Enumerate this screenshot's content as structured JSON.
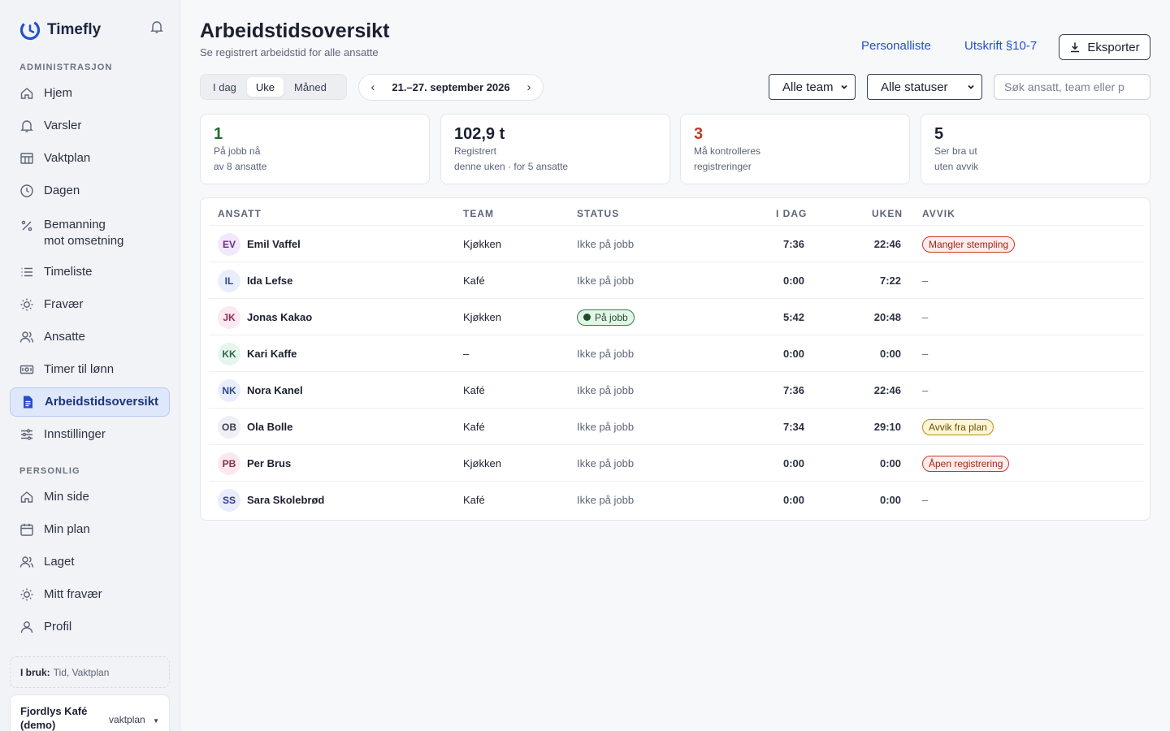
{
  "app": {
    "name": "Timefly"
  },
  "sidebar": {
    "admin_label": "ADMINISTRASJON",
    "admin_items": [
      {
        "label": "Hjem"
      },
      {
        "label": "Varsler"
      },
      {
        "label": "Vaktplan"
      },
      {
        "label": "Dagen"
      },
      {
        "label_line1": "Bemanning",
        "label_line2": "mot omsetning"
      },
      {
        "label": "Timeliste"
      },
      {
        "label": "Fravær"
      },
      {
        "label": "Ansatte"
      },
      {
        "label": "Timer til lønn"
      },
      {
        "label": "Arbeidstidsoversikt"
      },
      {
        "label": "Innstillinger"
      }
    ],
    "personal_label": "PERSONLIG",
    "personal_items": [
      {
        "label": "Min side"
      },
      {
        "label": "Min plan"
      },
      {
        "label": "Laget"
      },
      {
        "label": "Mitt fravær"
      },
      {
        "label": "Profil"
      }
    ],
    "in_use_label": "I bruk:",
    "in_use_value": "Tid, Vaktplan",
    "org_name": "Fjordlys Kafé (demo)",
    "org_plan": "vaktplan"
  },
  "header": {
    "title": "Arbeidstidsoversikt",
    "subtitle": "Se registrert arbeidstid for alle ansatte",
    "link_staff": "Personalliste",
    "link_print": "Utskrift §10-7",
    "export_label": "Eksporter"
  },
  "filters": {
    "period_tabs": [
      "I dag",
      "Uke",
      "Måned"
    ],
    "active_period": "Uke",
    "date_range": "21.–27. september 2026",
    "team_select": "Alle team",
    "status_select": "Alle statuser",
    "search_placeholder": "Søk ansatt, team eller p"
  },
  "summary_cards": [
    {
      "value": "1",
      "line1": "På jobb nå",
      "line2": "av 8 ansatte",
      "color": "#256b34"
    },
    {
      "value": "102,9 t",
      "line1": "Registrert",
      "line2": "denne uken · for 5 ansatte",
      "color": "#1b2030"
    },
    {
      "value": "3",
      "line1": "Må kontrolleres",
      "line2": "registreringer",
      "color": "#c23a2b"
    },
    {
      "value": "5",
      "line1": "Ser bra ut",
      "line2": "uten avvik",
      "color": "#1b2030"
    }
  ],
  "table": {
    "headers": {
      "employee": "ANSATT",
      "team": "TEAM",
      "status": "STATUS",
      "today": "I DAG",
      "week": "UKEN",
      "deviation": "AVVIK"
    },
    "rows": [
      {
        "initials": "EV",
        "name": "Emil Vaffel",
        "team": "Kjøkken",
        "status": "Ikke på jobb",
        "today": "7:36",
        "week": "22:46",
        "deviation": "Mangler stempling",
        "deviation_kind": "red"
      },
      {
        "initials": "IL",
        "name": "Ida Lefse",
        "team": "Kafé",
        "status": "Ikke på jobb",
        "today": "0:00",
        "week": "7:22",
        "deviation": "–",
        "deviation_kind": "none"
      },
      {
        "initials": "JK",
        "name": "Jonas Kakao",
        "team": "Kjøkken",
        "status": "På jobb",
        "today": "5:42",
        "week": "20:48",
        "deviation": "–",
        "deviation_kind": "none"
      },
      {
        "initials": "KK",
        "name": "Kari Kaffe",
        "team": "–",
        "status": "Ikke på jobb",
        "today": "0:00",
        "week": "0:00",
        "deviation": "–",
        "deviation_kind": "none"
      },
      {
        "initials": "NK",
        "name": "Nora Kanel",
        "team": "Kafé",
        "status": "Ikke på jobb",
        "today": "7:36",
        "week": "22:46",
        "deviation": "–",
        "deviation_kind": "none"
      },
      {
        "initials": "OB",
        "name": "Ola Bolle",
        "team": "Kafé",
        "status": "Ikke på jobb",
        "today": "7:34",
        "week": "29:10",
        "deviation": "Avvik fra plan",
        "deviation_kind": "yellow"
      },
      {
        "initials": "PB",
        "name": "Per Brus",
        "team": "Kjøkken",
        "status": "Ikke på jobb",
        "today": "0:00",
        "week": "0:00",
        "deviation": "Åpen registrering",
        "deviation_kind": "red"
      },
      {
        "initials": "SS",
        "name": "Sara Skolebrød",
        "team": "Kafé",
        "status": "Ikke på jobb",
        "today": "0:00",
        "week": "0:00",
        "deviation": "–",
        "deviation_kind": "none"
      }
    ]
  },
  "colors": {
    "accent": "#2450c8",
    "active_nav_bg": "#dfe7fb",
    "on_duty_green": "#256b34",
    "alert_red": "#c23a2b"
  }
}
